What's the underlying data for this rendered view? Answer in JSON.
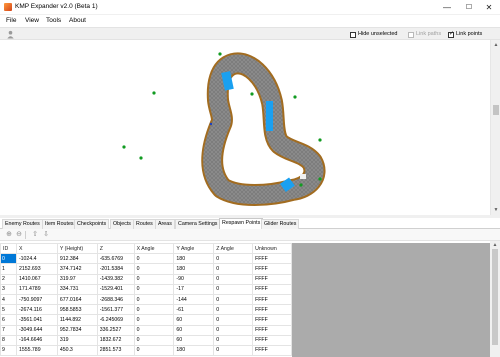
{
  "window": {
    "title": "KMP Expander v2.0 (Beta 1)",
    "controls": {
      "minimize": "—",
      "maximize": "☐",
      "close": "✕"
    }
  },
  "menu": [
    "File",
    "View",
    "Tools",
    "About"
  ],
  "toolbar": {
    "person_icon": "person-icon",
    "hide_unselected": {
      "label": "Hide unselected",
      "checked": false
    },
    "link_paths": {
      "label": "Link paths",
      "checked": false,
      "enabled": false
    },
    "link_points": {
      "label": "Link points",
      "checked": true
    }
  },
  "viewport": {
    "track_colors": {
      "asphalt": "#7d7d7d",
      "edge": "#a26c20",
      "boost": "#1aa0f0",
      "point": "#119b21"
    }
  },
  "tabs": [
    "Enemy Routes",
    "Item Routes",
    "Checkpoints",
    "Objects",
    "Routes",
    "Areas",
    "Camera Settings",
    "Respawn Points",
    "Glider Routes"
  ],
  "active_tab_index": 7,
  "grid": {
    "columns": [
      "ID",
      "X",
      "Y (Height)",
      "Z",
      "X Angle",
      "Y Angle",
      "Z Angle",
      "Unknown"
    ],
    "rows": [
      [
        "0",
        "-1024.4",
        "912.384",
        "-635.6769",
        "0",
        "180",
        "0",
        "FFFF"
      ],
      [
        "1",
        "2152.693",
        "374.7142",
        "-201.5384",
        "0",
        "180",
        "0",
        "FFFF"
      ],
      [
        "2",
        "1410.067",
        "319.97",
        "-1439.382",
        "0",
        "-90",
        "0",
        "FFFF"
      ],
      [
        "3",
        "171.4789",
        "334.731",
        "-1529.401",
        "0",
        "-17",
        "0",
        "FFFF"
      ],
      [
        "4",
        "-750.9097",
        "677.0164",
        "-2688.346",
        "0",
        "-144",
        "0",
        "FFFF"
      ],
      [
        "5",
        "-2674.116",
        "958.5853",
        "-1561.377",
        "0",
        "-61",
        "0",
        "FFFF"
      ],
      [
        "6",
        "-3561.041",
        "1144.892",
        "-6.245069",
        "0",
        "60",
        "0",
        "FFFF"
      ],
      [
        "7",
        "-3049.644",
        "952.7834",
        "336.2527",
        "0",
        "60",
        "0",
        "FFFF"
      ],
      [
        "8",
        "-164.6646",
        "319",
        "1832.672",
        "0",
        "60",
        "0",
        "FFFF"
      ],
      [
        "9",
        "1555.789",
        "450.3",
        "2851.573",
        "0",
        "180",
        "0",
        "FFFF"
      ]
    ]
  }
}
